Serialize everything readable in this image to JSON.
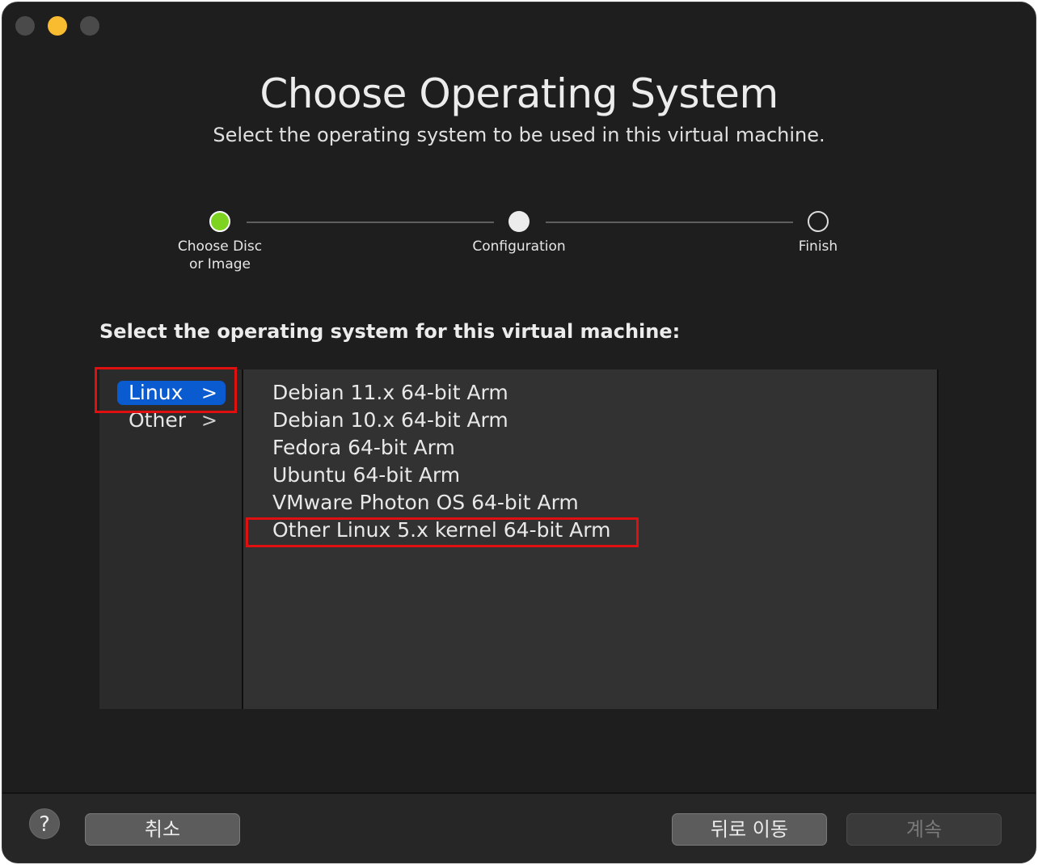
{
  "window": {
    "title": "Choose Operating System",
    "subtitle": "Select the operating system to be used in this virtual machine."
  },
  "steps": [
    {
      "label": "Choose Disc\nor Image",
      "state": "done"
    },
    {
      "label": "Configuration",
      "state": "current"
    },
    {
      "label": "Finish",
      "state": "pending"
    }
  ],
  "prompt": "Select the operating system for this virtual machine:",
  "categories": [
    {
      "label": "Linux",
      "selected": true
    },
    {
      "label": "Other",
      "selected": false
    }
  ],
  "os_list": [
    "Debian 11.x 64-bit Arm",
    "Debian 10.x 64-bit Arm",
    "Fedora 64-bit Arm",
    "Ubuntu 64-bit Arm",
    "VMware Photon OS 64-bit Arm",
    "Other Linux 5.x kernel 64-bit Arm"
  ],
  "footer": {
    "help_label": "?",
    "cancel_label": "취소",
    "back_label": "뒤로 이동",
    "continue_label": "계속"
  },
  "colors": {
    "accent": "#0a5bd0",
    "step_done": "#7ed321",
    "highlight_box": "#e01010"
  }
}
